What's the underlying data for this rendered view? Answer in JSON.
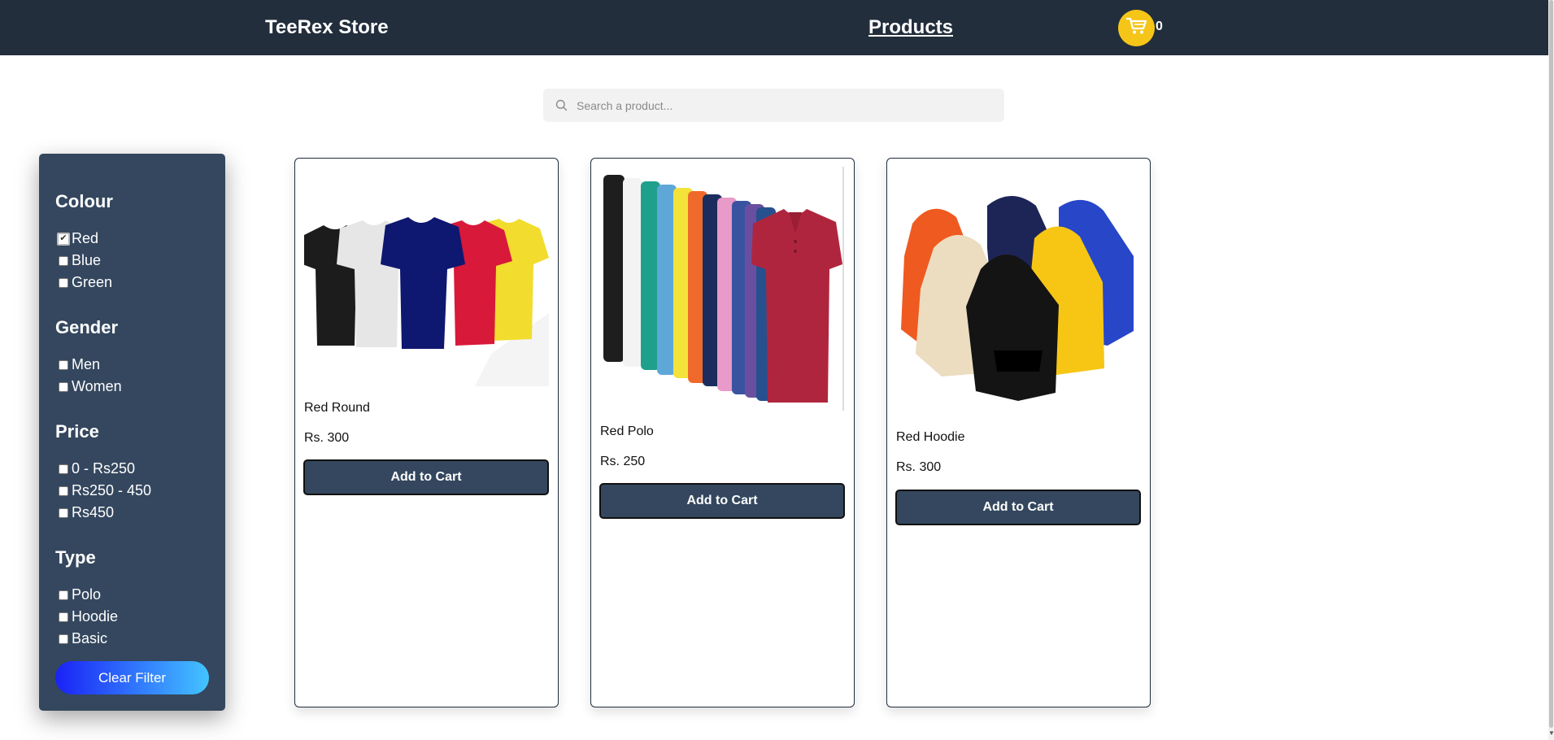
{
  "navbar": {
    "brand": "TeeRex Store",
    "products_link": "Products",
    "cart_count": "0"
  },
  "search": {
    "placeholder": "Search a product..."
  },
  "filters": {
    "colour": {
      "title": "Colour",
      "options": [
        {
          "label": "Red",
          "checked": true
        },
        {
          "label": "Blue",
          "checked": false
        },
        {
          "label": "Green",
          "checked": false
        }
      ]
    },
    "gender": {
      "title": "Gender",
      "options": [
        {
          "label": "Men",
          "checked": false
        },
        {
          "label": "Women",
          "checked": false
        }
      ]
    },
    "price": {
      "title": "Price",
      "options": [
        {
          "label": "0 - Rs250",
          "checked": false
        },
        {
          "label": "Rs250 - 450",
          "checked": false
        },
        {
          "label": "Rs450",
          "checked": false
        }
      ]
    },
    "type": {
      "title": "Type",
      "options": [
        {
          "label": "Polo",
          "checked": false
        },
        {
          "label": "Hoodie",
          "checked": false
        },
        {
          "label": "Basic",
          "checked": false
        }
      ]
    },
    "clear_label": "Clear Filter"
  },
  "products": [
    {
      "name": "Red Round",
      "price": "Rs. 300",
      "button": "Add to Cart",
      "image": "round-tshirts-image"
    },
    {
      "name": "Red Polo",
      "price": "Rs. 250",
      "button": "Add to Cart",
      "image": "polo-shirts-image"
    },
    {
      "name": "Red Hoodie",
      "price": "Rs. 300",
      "button": "Add to Cart",
      "image": "hoodies-image"
    }
  ],
  "colors": {
    "navbar": "#222e3c",
    "sidebar": "#34475e",
    "cart": "#f5c518",
    "button": "#34475e",
    "accent_gradient_start": "#1a22f5",
    "accent_gradient_end": "#43c4ff"
  }
}
